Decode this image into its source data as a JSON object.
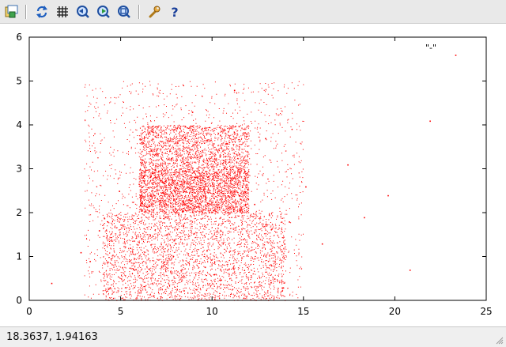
{
  "toolbar": {
    "buttons": [
      {
        "name": "export-button",
        "icon": "export-icon"
      },
      {
        "name": "replot-button",
        "icon": "replot-icon"
      },
      {
        "name": "grid-button",
        "icon": "grid-icon"
      },
      {
        "name": "zoom-previous-button",
        "icon": "zoom-previous-icon"
      },
      {
        "name": "zoom-next-button",
        "icon": "zoom-next-icon"
      },
      {
        "name": "unzoom-button",
        "icon": "unzoom-icon"
      },
      {
        "name": "settings-button",
        "icon": "wrench-icon"
      },
      {
        "name": "help-button",
        "icon": "help-icon"
      }
    ]
  },
  "status": {
    "coordinates": "18.3637,  1.94163"
  },
  "chart_data": {
    "type": "scatter",
    "title": "",
    "xlabel": "",
    "ylabel": "",
    "xlim": [
      0,
      25
    ],
    "ylim": [
      0,
      6
    ],
    "x_ticks": [
      "0",
      "5",
      "10",
      "15",
      "20",
      "25"
    ],
    "y_ticks": [
      "0",
      "1",
      "2",
      "3",
      "4",
      "5",
      "6"
    ],
    "grid": false,
    "legend_position": "top-right",
    "series": [
      {
        "name": "\"-\"",
        "color": "#ff0000",
        "marker": "dot",
        "dense_regions": [
          {
            "x": [
              4,
              14
            ],
            "y": [
              0,
              2
            ],
            "density": "very high"
          },
          {
            "x": [
              6,
              12
            ],
            "y": [
              2,
              3
            ],
            "density": "very high"
          },
          {
            "x": [
              6,
              12
            ],
            "y": [
              3,
              4
            ],
            "density": "high"
          },
          {
            "x": [
              3,
              15
            ],
            "y": [
              0,
              5
            ],
            "density": "medium"
          }
        ],
        "sample_points": [
          [
            1.2,
            0.4
          ],
          [
            2.8,
            1.1
          ],
          [
            3.3,
            0.9
          ],
          [
            3.8,
            1.6
          ],
          [
            4.4,
            0.3
          ],
          [
            4.9,
            2.5
          ],
          [
            5.5,
            1.2
          ],
          [
            6.2,
            3.6
          ],
          [
            6.8,
            2.4
          ],
          [
            7.3,
            0.8
          ],
          [
            7.9,
            3.9
          ],
          [
            8.4,
            1.7
          ],
          [
            8.9,
            4.3
          ],
          [
            9.5,
            2.8
          ],
          [
            10.1,
            0.6
          ],
          [
            10.6,
            3.2
          ],
          [
            11.2,
            4.8
          ],
          [
            11.7,
            1.4
          ],
          [
            12.3,
            2.2
          ],
          [
            12.9,
            3.7
          ],
          [
            13.4,
            0.5
          ],
          [
            14.2,
            1.8
          ],
          [
            15.1,
            2.6
          ],
          [
            16.0,
            1.3
          ],
          [
            17.4,
            3.1
          ],
          [
            18.3,
            1.9
          ],
          [
            19.6,
            2.4
          ],
          [
            20.8,
            0.7
          ],
          [
            21.9,
            4.1
          ],
          [
            23.3,
            5.6
          ]
        ]
      }
    ]
  }
}
